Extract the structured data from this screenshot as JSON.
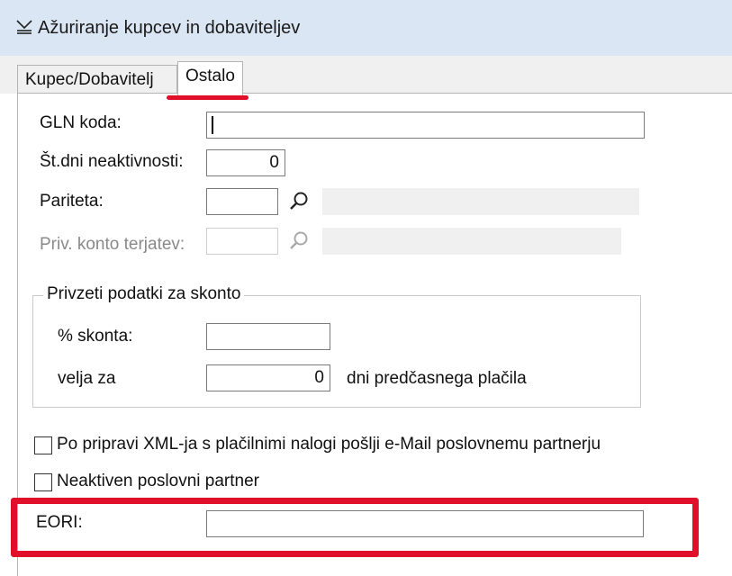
{
  "window": {
    "title": "Ažuriranje kupcev in dobaviteljev",
    "icon": "edit-window-icon"
  },
  "tabs": [
    {
      "label": "Kupec/Dobavitelj",
      "active": false
    },
    {
      "label": "Ostalo",
      "active": true
    }
  ],
  "form": {
    "gln_label": "GLN koda:",
    "gln_value": "",
    "inactivity_label": "Št.dni neaktivnosti:",
    "inactivity_value": "0",
    "parity_label": "Pariteta:",
    "parity_value": "",
    "priv_account_label": "Priv. konto terjatev:",
    "priv_account_value": "",
    "discount_group": {
      "title": "Privzeti podatki za skonto",
      "discount_label": "% skonta:",
      "discount_value": "",
      "valid_label": "velja za",
      "valid_value": "0",
      "valid_suffix": "dni predčasnega plačila"
    },
    "send_email_label": "Po pripravi XML-ja s plačilnimi nalogi pošlji e-Mail poslovnemu partnerju",
    "send_email_checked": false,
    "inactive_partner_label": "Neaktiven poslovni partner",
    "inactive_partner_checked": false,
    "eori_label": "EORI:",
    "eori_value": ""
  },
  "colors": {
    "titlebar": "#dae6f3",
    "highlight": "#e0102a"
  }
}
